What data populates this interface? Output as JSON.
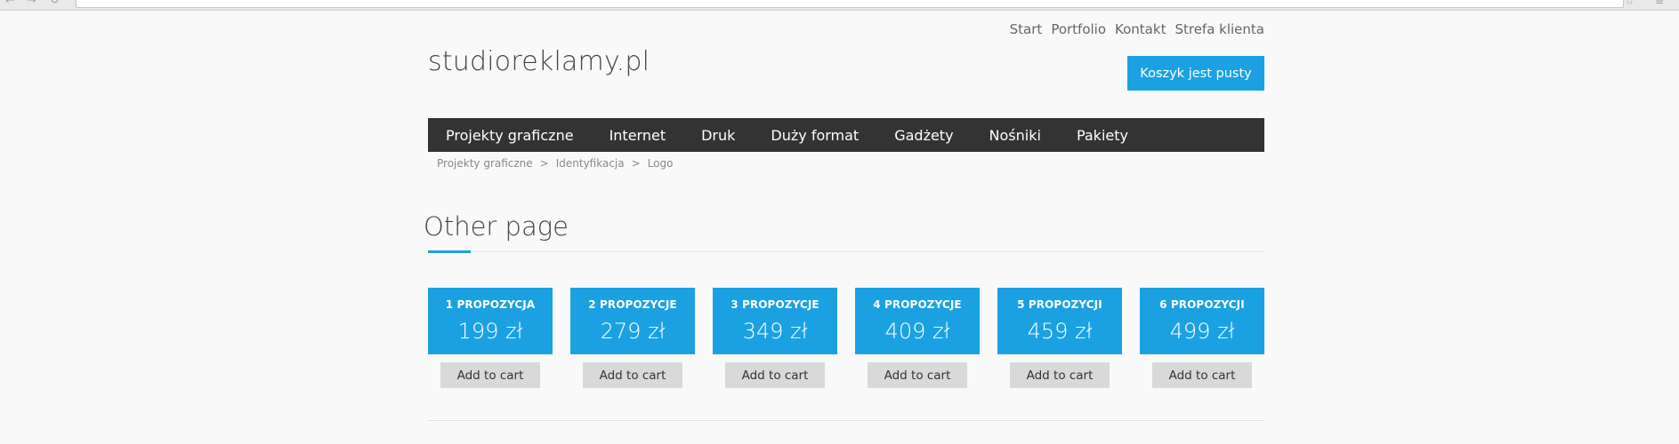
{
  "browser": {
    "back_glyph": "←",
    "forward_glyph": "→",
    "reload_glyph": "↻",
    "star_glyph": "☆",
    "menu_glyph": "≡"
  },
  "header": {
    "top_links": [
      "Start",
      "Portfolio",
      "Kontakt",
      "Strefa klienta"
    ],
    "logo": "studioreklamy.pl",
    "cart_label": "Koszyk jest pusty"
  },
  "nav": {
    "items": [
      "Projekty graficzne",
      "Internet",
      "Druk",
      "Duży format",
      "Gadżety",
      "Nośniki",
      "Pakiety"
    ]
  },
  "breadcrumb": {
    "items": [
      "Projekty graficzne",
      "Identyfikacja",
      "Logo"
    ],
    "separator": ">"
  },
  "page": {
    "title": "Other page"
  },
  "offers": [
    {
      "name": "1 PROPOZYCJA",
      "price": "199 zł",
      "button": "Add to cart"
    },
    {
      "name": "2 PROPOZYCJE",
      "price": "279 zł",
      "button": "Add to cart"
    },
    {
      "name": "3 PROPOZYCJE",
      "price": "349 zł",
      "button": "Add to cart"
    },
    {
      "name": "4 PROPOZYCJE",
      "price": "409 zł",
      "button": "Add to cart"
    },
    {
      "name": "5 PROPOZYCJI",
      "price": "459 zł",
      "button": "Add to cart"
    },
    {
      "name": "6 PROPOZYCJI",
      "price": "499 zł",
      "button": "Add to cart"
    }
  ],
  "colors": {
    "accent": "#1ba1e2",
    "nav_bg": "#333333",
    "button_gray": "#d9d9d9"
  }
}
